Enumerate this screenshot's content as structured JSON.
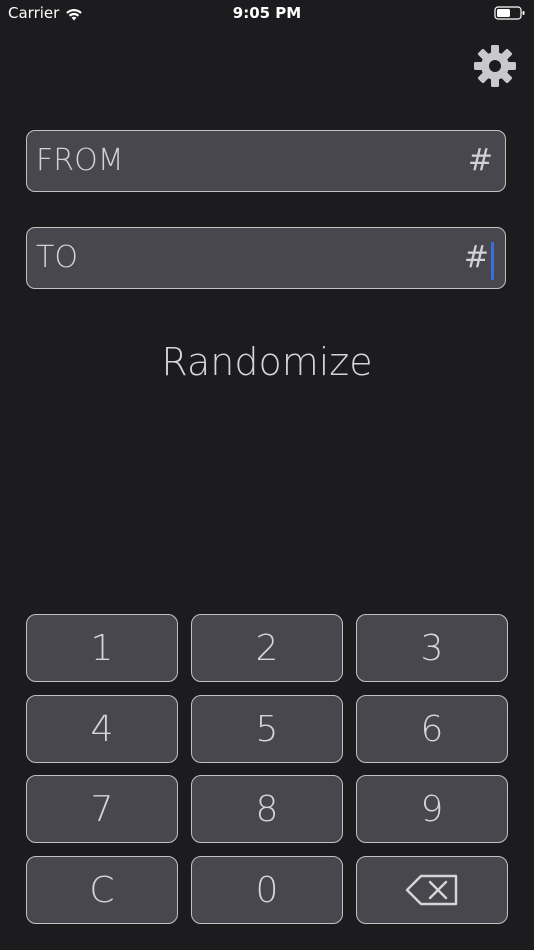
{
  "status_bar": {
    "carrier": "Carrier",
    "time": "9:05 PM"
  },
  "icons": {
    "wifi": "wifi-icon",
    "battery": "battery-icon",
    "settings": "gear-icon",
    "backspace": "backspace-icon"
  },
  "fields": {
    "from": {
      "label": "FROM",
      "suffix": "#"
    },
    "to": {
      "label": "TO",
      "suffix": "#"
    }
  },
  "randomize_label": "Randomize",
  "keypad": {
    "k1": "1",
    "k2": "2",
    "k3": "3",
    "k4": "4",
    "k5": "5",
    "k6": "6",
    "k7": "7",
    "k8": "8",
    "k9": "9",
    "clear": "C",
    "k0": "0"
  },
  "colors": {
    "background": "#1c1c1e",
    "key_fill": "#48474d",
    "key_border": "#c2c2c6",
    "cursor": "#3b6fe0"
  }
}
